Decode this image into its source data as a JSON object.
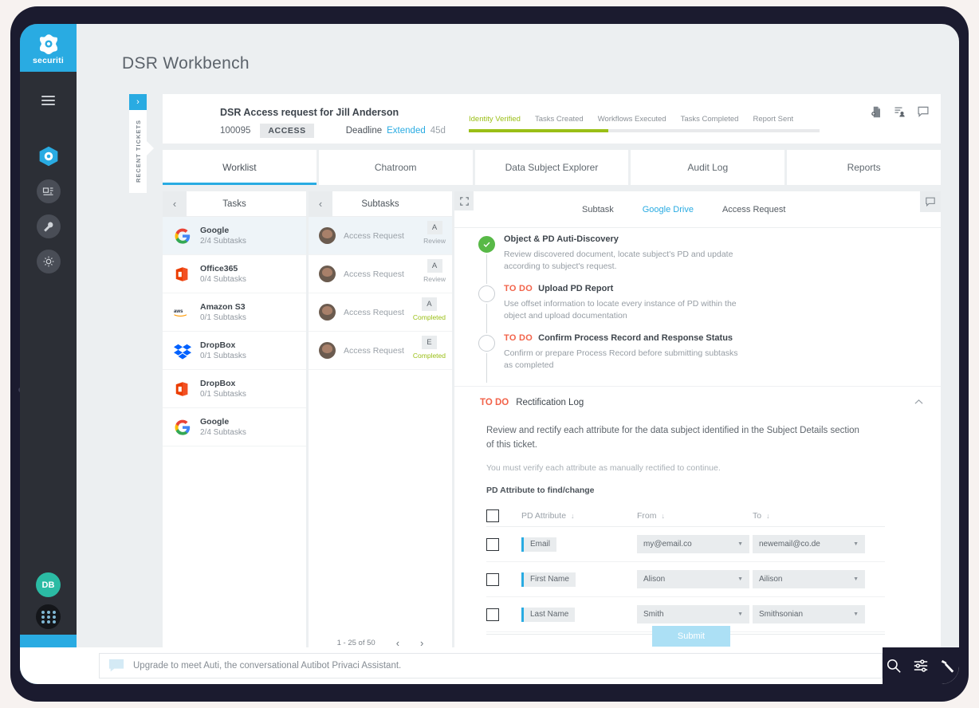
{
  "brand": {
    "name": "securiti"
  },
  "page": {
    "title": "DSR Workbench"
  },
  "recent_tickets_tab": {
    "label": "RECENT TICKETS",
    "arrow": "›"
  },
  "ticket": {
    "title": "DSR Access request for Jill Anderson",
    "id": "100095",
    "type_chip": "ACCESS",
    "deadline_label": "Deadline",
    "deadline_status": "Extended",
    "deadline_days": "45d",
    "steps": [
      {
        "label": "Identity Verified",
        "done": true
      },
      {
        "label": "Tasks Created",
        "done": false
      },
      {
        "label": "Workflows Executed",
        "done": false
      },
      {
        "label": "Tasks Completed",
        "done": false
      },
      {
        "label": "Report Sent",
        "done": false
      }
    ],
    "progress_percent": 40,
    "icons": [
      "add-document-icon",
      "assign-user-icon",
      "comment-icon"
    ]
  },
  "tabs": [
    {
      "label": "Worklist",
      "active": true
    },
    {
      "label": "Chatroom",
      "active": false
    },
    {
      "label": "Data Subject Explorer",
      "active": false
    },
    {
      "label": "Audit Log",
      "active": false
    },
    {
      "label": "Reports",
      "active": false
    }
  ],
  "tasks_pane": {
    "title": "Tasks",
    "back_icon": "‹",
    "items": [
      {
        "name": "Google",
        "subtasks": "2/4 Subtasks",
        "logo": "google",
        "selected": true
      },
      {
        "name": "Office365",
        "subtasks": "0/4 Subtasks",
        "logo": "office",
        "selected": false
      },
      {
        "name": "Amazon S3",
        "subtasks": "0/1 Subtasks",
        "logo": "aws",
        "selected": false
      },
      {
        "name": "DropBox",
        "subtasks": "0/1 Subtasks",
        "logo": "dropbox",
        "selected": false
      },
      {
        "name": "DropBox",
        "subtasks": "0/1 Subtasks",
        "logo": "office",
        "selected": false
      },
      {
        "name": "Google",
        "subtasks": "2/4 Subtasks",
        "logo": "google",
        "selected": false
      }
    ]
  },
  "subtasks_pane": {
    "title": "Subtasks",
    "back_icon": "‹",
    "items": [
      {
        "name": "Access Request",
        "badge": "A",
        "status": "Review",
        "status_color": "grey",
        "selected": true
      },
      {
        "name": "Access Request",
        "badge": "A",
        "status": "Review",
        "status_color": "grey",
        "selected": false
      },
      {
        "name": "Access Request",
        "badge": "A",
        "status": "Completed",
        "status_color": "green",
        "selected": false
      },
      {
        "name": "Access Request",
        "badge": "E",
        "status": "Completed",
        "status_color": "green",
        "selected": false
      }
    ],
    "pagination": {
      "range": "1 - 25 of 50",
      "prev": "‹",
      "next": "›"
    }
  },
  "detail": {
    "breadcrumb": {
      "subtask": "Subtask",
      "source": "Google Drive",
      "request": "Access Request"
    },
    "steps": [
      {
        "status": "done",
        "todo_label": "",
        "title": "Object & PD Auti-Discovery",
        "description": "Review discovered document, locate subject's PD and update according to subject's request."
      },
      {
        "status": "todo",
        "todo_label": "TO DO",
        "title": "Upload PD Report",
        "description": "Use offset information to locate every instance of PD within the object and upload documentation"
      },
      {
        "status": "todo",
        "todo_label": "TO DO",
        "title": "Confirm Process Record and Response Status",
        "description": "Confirm or prepare Process Record before submitting subtasks as completed"
      }
    ],
    "rectification": {
      "todo_label": "TO DO",
      "title": "Rectification Log",
      "chevron": "⌃",
      "paragraph": "Review and rectify each attribute for the data subject identified in the Subject Details section of this ticket.",
      "note": "You must verify each attribute as manually rectified to continue.",
      "table_caption": "PD Attribute to find/change",
      "columns": [
        "PD Attribute",
        "From",
        "To"
      ],
      "sort_icon": "↓",
      "rows": [
        {
          "attribute": "Email",
          "from": "my@email.co",
          "to": "newemail@co.de",
          "checked": false
        },
        {
          "attribute": "First Name",
          "from": "Alison",
          "to": "Ailison",
          "checked": false
        },
        {
          "attribute": "Last Name",
          "from": "Smith",
          "to": "Smithsonian",
          "checked": false
        }
      ],
      "submit_label": "Submit"
    }
  },
  "bottom_bar": {
    "placeholder": "Upgrade to meet Auti, the conversational Autibot Privaci Assistant.",
    "tools": [
      "search-icon",
      "filter-sliders-icon",
      "hammer-icon"
    ]
  },
  "user": {
    "initials": "DB"
  },
  "colors": {
    "brand_blue": "#29abe2",
    "progress_green": "#9abf16",
    "todo_red": "#f2634a",
    "completed_green": "#9abf16",
    "avatar_teal": "#2bbba4",
    "submit_blue": "#ace0f5"
  }
}
